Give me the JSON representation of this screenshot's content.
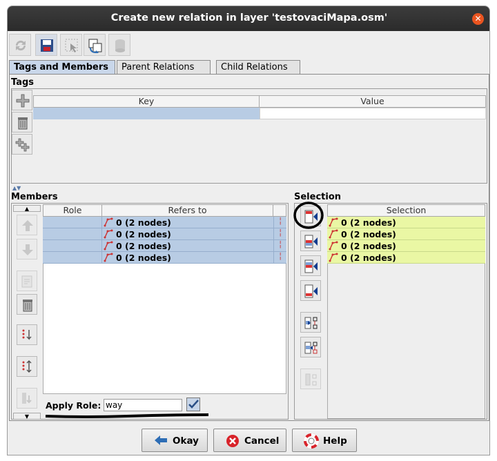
{
  "window": {
    "title": "Create new relation in layer 'testovaciMapa.osm'"
  },
  "toolbar": {
    "icons": [
      "refresh-icon",
      "save-icon",
      "select-icon",
      "zoom-icon",
      "delete-db-icon"
    ]
  },
  "tabs": [
    {
      "label": "Tags and Members",
      "active": true
    },
    {
      "label": "Parent Relations",
      "active": false
    },
    {
      "label": "Child Relations",
      "active": false
    }
  ],
  "tags": {
    "title": "Tags",
    "columns": {
      "key": "Key",
      "value": "Value"
    },
    "rows": [
      {
        "key": "",
        "value": ""
      }
    ]
  },
  "members": {
    "title": "Members",
    "columns": {
      "role": "Role",
      "refers_to": "Refers to"
    },
    "rows": [
      {
        "role": "",
        "refers": "0 (2 nodes)"
      },
      {
        "role": "",
        "refers": "0 (2 nodes)"
      },
      {
        "role": "",
        "refers": "0 (2 nodes)"
      },
      {
        "role": "",
        "refers": "0 (2 nodes)"
      }
    ],
    "apply_role_label": "Apply Role:",
    "apply_role_value": "way"
  },
  "selection": {
    "title": "Selection",
    "column": "Selection",
    "rows": [
      {
        "text": "0 (2 nodes)"
      },
      {
        "text": "0 (2 nodes)"
      },
      {
        "text": "0 (2 nodes)"
      },
      {
        "text": "0 (2 nodes)"
      }
    ]
  },
  "buttons": {
    "okay": "Okay",
    "cancel": "Cancel",
    "help": "Help"
  },
  "colors": {
    "selected_row": "#b8cce4",
    "selection_row": "#eaf7a4",
    "accent": "#e95420"
  }
}
